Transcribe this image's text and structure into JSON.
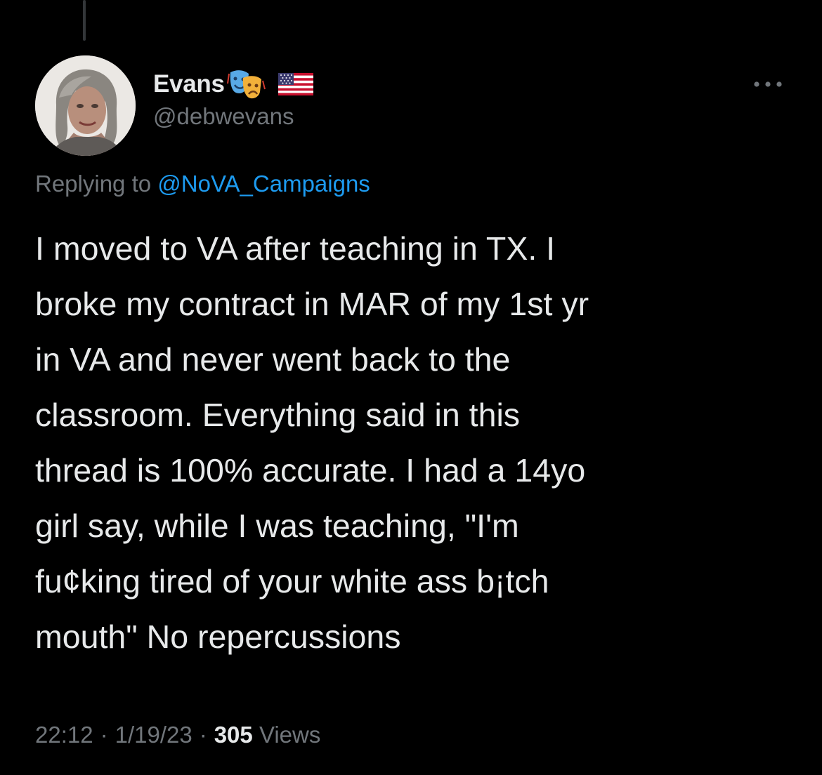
{
  "tweet": {
    "author": {
      "display_name": "Evans",
      "emojis": [
        "performing-arts-emoji",
        "us-flag-emoji"
      ],
      "handle": "@debwevans",
      "avatar": "profile-photo"
    },
    "more_icon": "more-dots-icon",
    "reply": {
      "prefix": "Replying to",
      "target": "@NoVA_Campaigns"
    },
    "text_lines": [
      "I moved to VA after teaching in TX. I",
      "broke my contract in MAR of my 1st yr",
      "in VA and never went back to the",
      "classroom. Everything said in this",
      "thread is 100% accurate. I had a 14yo",
      "girl say, while I was teaching, \"I'm",
      "fu¢king tired of your white ass b¡tch",
      "mouth\" No repercussions"
    ],
    "time": "22:12",
    "date": "1/19/23",
    "separator": "·",
    "views_count": "305",
    "views_label": "Views"
  },
  "colors": {
    "background": "#000000",
    "primary_text": "#e7e9ea",
    "secondary_text": "#71767b",
    "link": "#1d9bf0",
    "thread_line": "#333639"
  }
}
